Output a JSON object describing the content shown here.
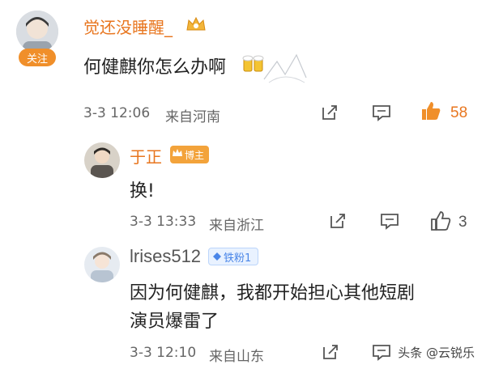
{
  "comments": [
    {
      "username": "觉还没睡醒_",
      "follow_label": "关注",
      "text": "何健麒你怎么办啊",
      "time": "3-3 12:06",
      "location": "来自河南",
      "likes": "58"
    },
    {
      "username": "于正",
      "badge": "博主",
      "text": "换!",
      "time": "3-3 13:33",
      "location": "来自浙江",
      "likes": "3"
    },
    {
      "username": "lrises512",
      "badge": "铁粉1",
      "text_line1": "因为何健麒，我都开始担心其他短剧",
      "text_line2": "演员爆雷了",
      "time": "3-3 12:10",
      "location": "来自山东"
    }
  ],
  "watermark": "头条 @云锐乐",
  "colors": {
    "accent_orange": "#e8761f",
    "fan_blue": "#4a86e8"
  }
}
